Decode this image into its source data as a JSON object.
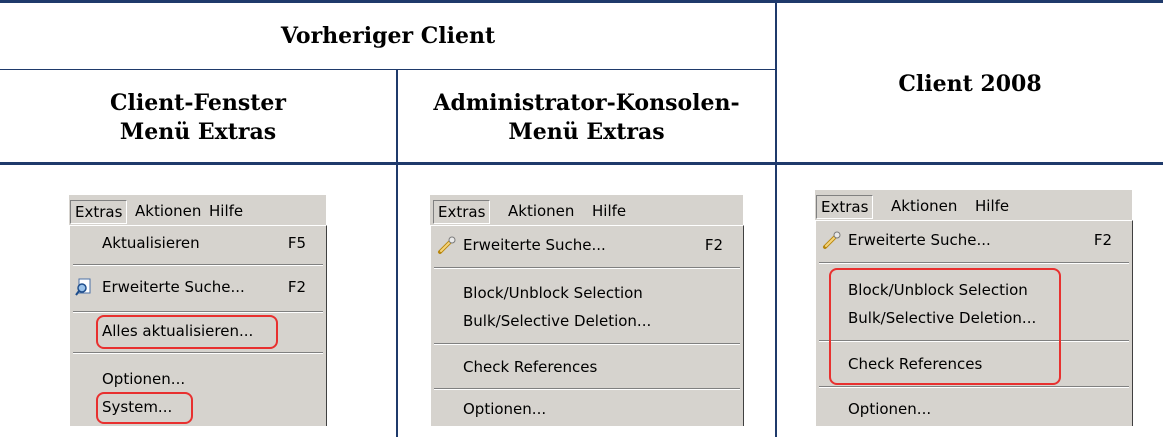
{
  "table": {
    "header_previous": "Vorheriger Client",
    "header_2008": "Client 2008",
    "col1_line1": "Client-Fenster",
    "col1_line2": "Menü Extras",
    "col2_line1": "Administrator-Konsolen-",
    "col2_line2": "Menü Extras"
  },
  "menubar": {
    "extras": "Extras",
    "aktionen": "Aktionen",
    "hilfe": "Hilfe"
  },
  "col1": {
    "items": [
      {
        "label": "Aktualisieren",
        "key": "F5"
      },
      {
        "label": "Erweiterte Suche...",
        "key": "F2"
      },
      {
        "label": "Alles aktualisieren...",
        "key": ""
      },
      {
        "label": "Optionen...",
        "key": ""
      },
      {
        "label": "System...",
        "key": ""
      }
    ]
  },
  "col2": {
    "items": [
      {
        "label": "Erweiterte Suche...",
        "key": "F2"
      },
      {
        "label": "Block/Unblock Selection",
        "key": ""
      },
      {
        "label": "Bulk/Selective Deletion...",
        "key": ""
      },
      {
        "label": "Check References",
        "key": ""
      },
      {
        "label": "Optionen...",
        "key": ""
      }
    ]
  },
  "col3": {
    "items": [
      {
        "label": "Erweiterte Suche...",
        "key": "F2"
      },
      {
        "label": "Block/Unblock Selection",
        "key": ""
      },
      {
        "label": "Bulk/Selective Deletion...",
        "key": ""
      },
      {
        "label": "Check References",
        "key": ""
      },
      {
        "label": "Optionen...",
        "key": ""
      }
    ]
  },
  "colors": {
    "rule": "#1f3a6b",
    "highlight": "#e8302f",
    "menu_bg": "#d6d3ce"
  }
}
